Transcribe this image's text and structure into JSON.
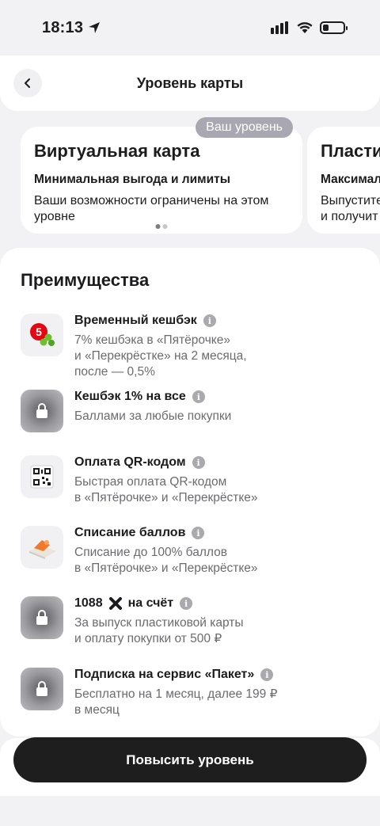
{
  "status_bar": {
    "time": "18:13"
  },
  "header": {
    "title": "Уровень карты",
    "back_icon": "chevron-left-icon"
  },
  "levels": [
    {
      "badge": "Ваш уровень",
      "name": "Виртуальная карта",
      "subtitle": "Минимальная выгода и лимиты",
      "description": "Ваши возможности ограничены на этом\nуровне"
    },
    {
      "name": "Пласти",
      "subtitle": "Максимал",
      "description": "Выпустите\nи получит"
    }
  ],
  "benefits": {
    "title": "Преимущества",
    "items": [
      {
        "title": "Временный кешбэк",
        "description": "7% кешбэка в «Пятёрочке»\nи «Перекрёстке» на 2 месяца,\nпосле — 0,5%",
        "icon": "pyaterochka-logo-icon",
        "locked": false
      },
      {
        "title": "Кешбэк 1% на все",
        "description": "Баллами за любые покупки",
        "icon": "lock-icon",
        "locked": true
      },
      {
        "title": "Оплата QR-кодом",
        "description": "Быстрая оплата QR-кодом\nв «Пятёрочке» и «Перекрёстке»",
        "icon": "qr-code-icon",
        "locked": false
      },
      {
        "title": "Списание баллов",
        "description": "Списание до 100% баллов\nв «Пятёрочке» и «Перекрёстке»",
        "icon": "points-icon",
        "locked": false
      },
      {
        "title": "1088",
        "title_suffix": "на счёт",
        "description": "За выпуск пластиковой карты\nи оплату покупки от 500 ₽",
        "icon": "lock-icon",
        "locked": true
      },
      {
        "title": "Подписка на сервис «Пакет»",
        "description": "Бесплатно на 1 месяц, далее 199 ₽\nв месяц",
        "icon": "lock-icon",
        "locked": true
      }
    ]
  },
  "action": {
    "label": "Повысить уровень"
  }
}
